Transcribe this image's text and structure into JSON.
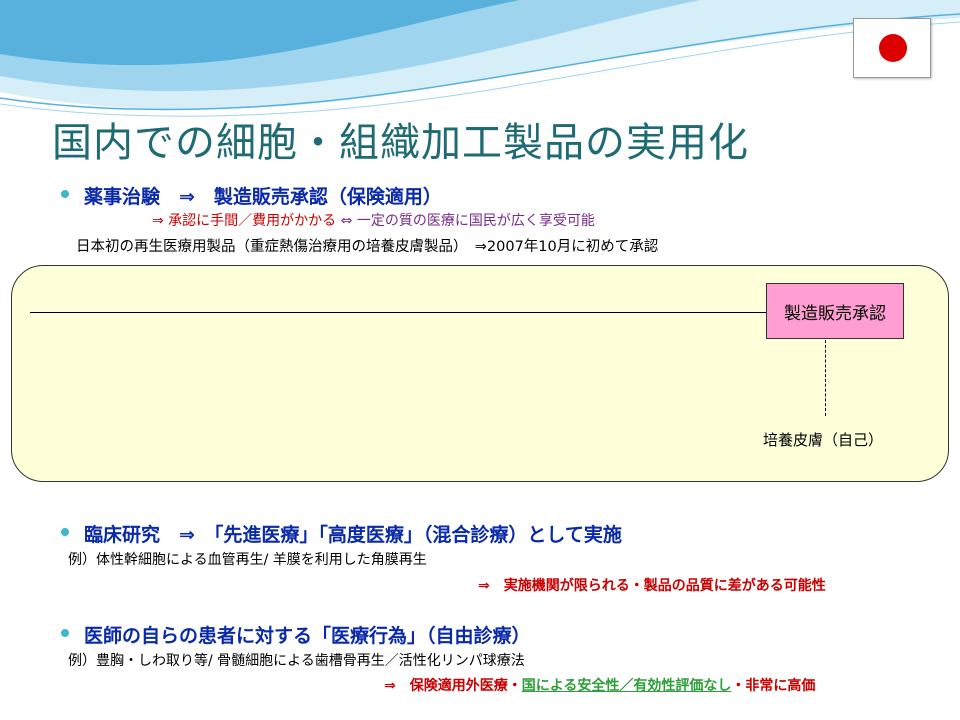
{
  "title": "国内での細胞・組織加工製品の実用化",
  "colors": {
    "title": "#1f6b74",
    "heading": "#0a2aa8",
    "red": "#cc0000",
    "bullet": "#3cb8c8",
    "panel": "#ffffd9",
    "approval_box": "#ff9ed2",
    "flag_disc": "#dd0000",
    "wave_light": "#d6eef8",
    "wave_mid": "#9fd4ee",
    "wave_dark": "#57b1dc",
    "green_link": "#2e9d3a"
  },
  "sections": {
    "clinical_trial": {
      "heading": "薬事治験　⇒　製造販売承認（保険適用）",
      "note_red": "⇒ 承認に手間／費用がかかる",
      "note_arrow": "⇔",
      "note_purple": "一定の質の医療に国民が広く享受可能",
      "example": "日本初の再生医療用製品（重症熱傷治療用の培養皮膚製品）　⇒2007年10月に初めて承認"
    },
    "clinical_research": {
      "heading": "臨床研究　⇒　「先進医療」「高度医療」（混合診療）として実施",
      "example": "例）体性幹細胞による血管再生/ 羊膜を利用した角膜再生",
      "note": "⇒　実施機関が限られる・製品の品質に差がある可能性"
    },
    "medical_practice": {
      "heading": "医師の自らの患者に対する「医療行為」（自由診療）",
      "example": "例）豊胸・しわ取り等/ 骨髄細胞による歯槽骨再生／活性化リンパ球療法",
      "note_prefix": "⇒　保険適用外医療・",
      "note_link": "国による安全性／有効性評価なし",
      "note_suffix": "・非常に高価"
    }
  },
  "diagram": {
    "approval_label": "製造販売承認",
    "product_label": "培養皮膚（自己）"
  }
}
